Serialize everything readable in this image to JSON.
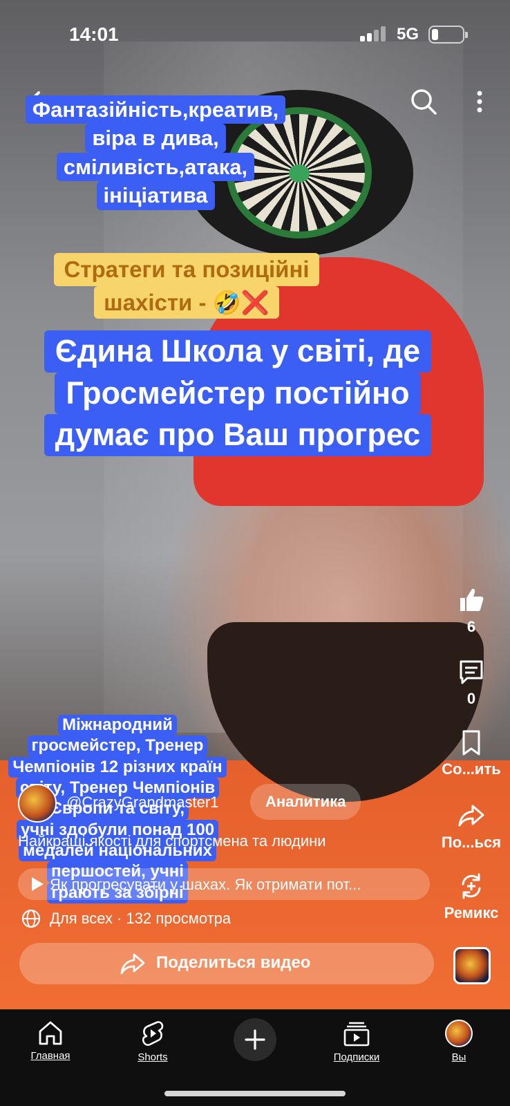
{
  "status_bar": {
    "time": "14:01",
    "network": "5G"
  },
  "overlay": {
    "box1_lines": [
      "Фантазійність,креатив,",
      "віра в дива,",
      "сміливість,атака,",
      "ініціатива"
    ],
    "box2_lines": [
      "Стратеги та позиційні",
      "шахісти - 🤣❌"
    ],
    "box3_lines": [
      "Єдина Школа у світі, де",
      "Гросмейстер постійно",
      "думає про Ваш прогрес"
    ],
    "box4_lines": [
      "Міжнародний",
      "гросмейстер, Тренер",
      "Чемпіонів 12 різних країн",
      "світу, Тренер Чемпіонів",
      "Європи та світу,",
      "учні здобули понад 100",
      "медалей національних",
      "першостей, учні",
      "грають за збірні"
    ]
  },
  "actions": {
    "likes": "6",
    "comments": "0",
    "save_label": "Со...ить",
    "share_label": "По...ься",
    "remix_label": "Ремикс"
  },
  "channel": {
    "name": "@CrazyGrandmaster1",
    "analytics_label": "Аналитика"
  },
  "video": {
    "description": "Найкращі якості для спортсмена та людини",
    "playlist": "Як прогресувати у шахах. Як отримати пот...",
    "audience": "Для всех",
    "views": "132 просмотра",
    "meta_text": "Для всех · 132 просмотра",
    "share_video_label": "Поделиться видео"
  },
  "bottom_nav": {
    "home": "Главная",
    "shorts": "Shorts",
    "subscriptions": "Подписки",
    "you": "Вы"
  },
  "icons": {
    "back": "back-arrow-icon",
    "search": "search-icon",
    "more": "more-vertical-icon",
    "like": "thumbs-up-icon",
    "comment": "comment-icon",
    "save": "bookmark-icon",
    "share": "share-icon",
    "remix": "remix-icon",
    "globe": "globe-icon",
    "create": "plus-icon"
  },
  "colors": {
    "caption_blue": "#3b5ef5",
    "caption_yellow": "#f7d56a",
    "nav_background": "#0f0f0f"
  }
}
